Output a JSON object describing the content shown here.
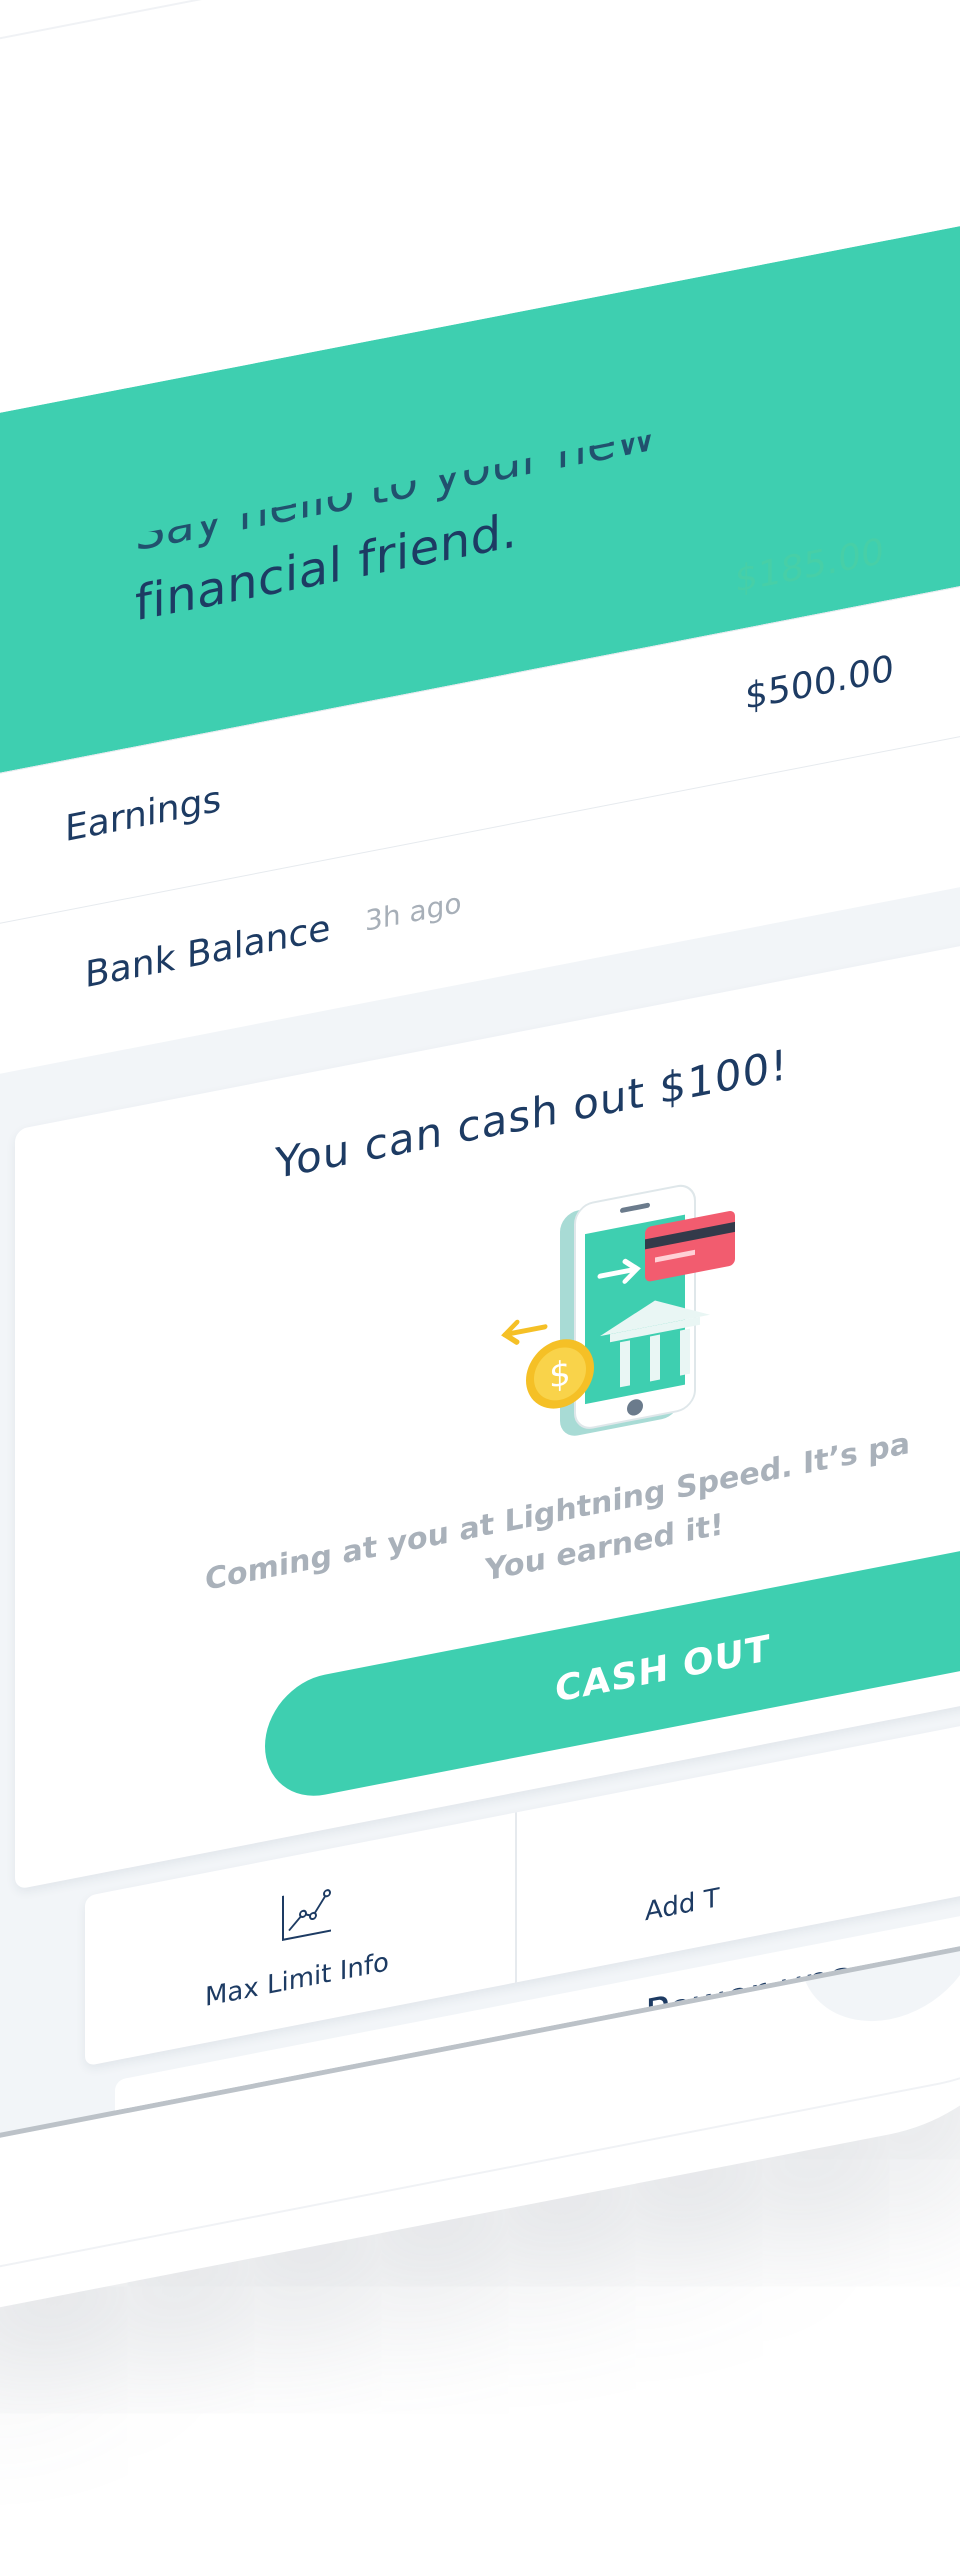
{
  "hero": {
    "title_line_1": "financial friend.",
    "title_partial": "Say hello to your new"
  },
  "balances": {
    "green_amount": "$185.00",
    "earnings_label": "Earnings",
    "earnings_value": "$500.00",
    "bank_label": "Bank Balance",
    "bank_meta": "3h ago"
  },
  "cashout_card": {
    "title": "You can cash out $100!",
    "description_line_1": "Coming at you at Lightning Speed.  It’s pa",
    "description_line_2": "You earned it!",
    "button_label": "CASH OUT"
  },
  "tiles": {
    "max_limit_label": "Max Limit Info",
    "add_label": "Add T"
  },
  "powerups": {
    "title": "Power ups"
  },
  "colors": {
    "accent": "#3ecfb0",
    "text_primary": "#1d3b63",
    "muted": "#a9b1ba",
    "background": "#f2f5f8"
  }
}
